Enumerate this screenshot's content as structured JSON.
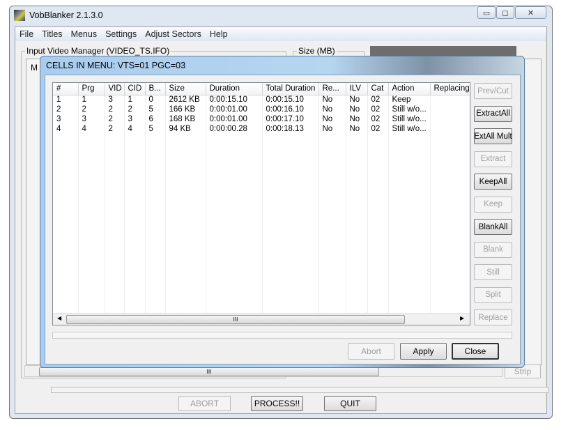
{
  "window": {
    "title": "VobBlanker 2.1.3.0",
    "minimize": "▭",
    "maximize": "◻",
    "close": "✕"
  },
  "menu": [
    "File",
    "Titles",
    "Menus",
    "Settings",
    "Adjust Sectors",
    "Help"
  ],
  "main": {
    "group_input": "Input Video Manager (VIDEO_TS.IFO)",
    "group_size": "Size (MB)",
    "tab_stub": "M",
    "strip_label": "Strip",
    "abort_label": "ABORT",
    "process_label": "PROCESS!!",
    "quit_label": "QUIT"
  },
  "dialog": {
    "title": "CELLS IN MENU: VTS=01 PGC=03",
    "columns": [
      "#",
      "Prg",
      "VID",
      "CID",
      "B...",
      "Size",
      "Duration",
      "Total Duration",
      "Re...",
      "ILV",
      "Cat",
      "Action",
      "Replacing"
    ],
    "rows": [
      [
        "1",
        "1",
        "3",
        "1",
        "0",
        "2612 KB",
        "0:00:15.10",
        "0:00:15.10",
        "No",
        "No",
        "02",
        "Keep",
        ""
      ],
      [
        "2",
        "2",
        "2",
        "2",
        "5",
        "166 KB",
        "0:00:01.00",
        "0:00:16.10",
        "No",
        "No",
        "02",
        "Still w/o...",
        ""
      ],
      [
        "3",
        "3",
        "2",
        "3",
        "6",
        "168 KB",
        "0:00:01.00",
        "0:00:17.10",
        "No",
        "No",
        "02",
        "Still w/o...",
        ""
      ],
      [
        "4",
        "4",
        "2",
        "4",
        "5",
        "94 KB",
        "0:00:00.28",
        "0:00:18.13",
        "No",
        "No",
        "02",
        "Still w/o...",
        ""
      ]
    ],
    "side_buttons": [
      {
        "label": "Prev/Cut",
        "enabled": false
      },
      {
        "label": "ExtractAll",
        "enabled": true
      },
      {
        "label": "ExtAll Mult",
        "enabled": true
      },
      {
        "label": "Extract",
        "enabled": false
      },
      {
        "label": "KeepAll",
        "enabled": true
      },
      {
        "label": "Keep",
        "enabled": false
      },
      {
        "label": "BlankAll",
        "enabled": true
      },
      {
        "label": "Blank",
        "enabled": false
      },
      {
        "label": "Still",
        "enabled": false
      },
      {
        "label": "Split",
        "enabled": false
      },
      {
        "label": "Replace",
        "enabled": false
      }
    ],
    "scroll_grip": "III",
    "abort_label": "Abort",
    "apply_label": "Apply",
    "close_label": "Close"
  }
}
